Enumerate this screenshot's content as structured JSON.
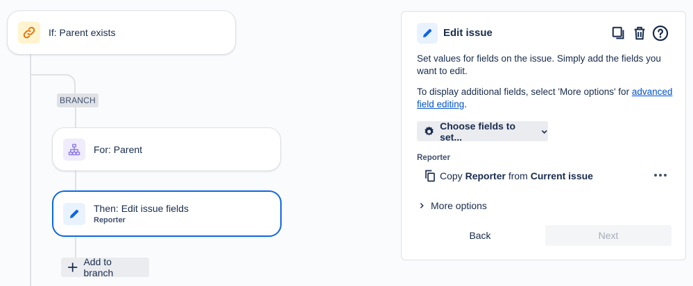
{
  "flow": {
    "if_card": {
      "title": "If: Parent exists"
    },
    "branch_tag": "BRANCH",
    "for_card": {
      "title": "For: Parent"
    },
    "then_card": {
      "title": "Then: Edit issue fields",
      "subtitle": "Reporter"
    },
    "add_button": {
      "label": "Add to branch"
    }
  },
  "panel": {
    "title": "Edit issue",
    "description": "Set values for fields on the issue. Simply add the fields you want to edit.",
    "additional_prefix": "To display additional fields, select 'More options' for ",
    "additional_link": "advanced field editing",
    "additional_suffix": ".",
    "choose_fields_label": "Choose fields to set...",
    "field_label": "Reporter",
    "copy_row": {
      "prefix": "Copy ",
      "field": "Reporter",
      "middle": " from ",
      "source": "Current issue"
    },
    "more_options": "More options",
    "back_label": "Back",
    "next_label": "Next"
  },
  "colors": {
    "accent_blue": "#0c66e4",
    "link_blue": "#0052cc",
    "if_icon_bg": "#fff4cf",
    "if_icon": "#e2740e",
    "for_icon_bg": "#f0ecfb",
    "for_icon": "#8f7ee7",
    "edit_icon_bg": "#e9f2ff"
  },
  "icons": {
    "if": "link-icon",
    "for": "hierarchy-icon",
    "then": "pencil-icon",
    "add": "plus-icon",
    "panel_title": "pencil-icon",
    "copy": "copy-icon",
    "delete": "trash-icon",
    "help": "help-icon",
    "gear": "gear-icon",
    "chevron": "chevron-down-icon",
    "more": "more-icon",
    "expand": "chevron-right-icon"
  }
}
